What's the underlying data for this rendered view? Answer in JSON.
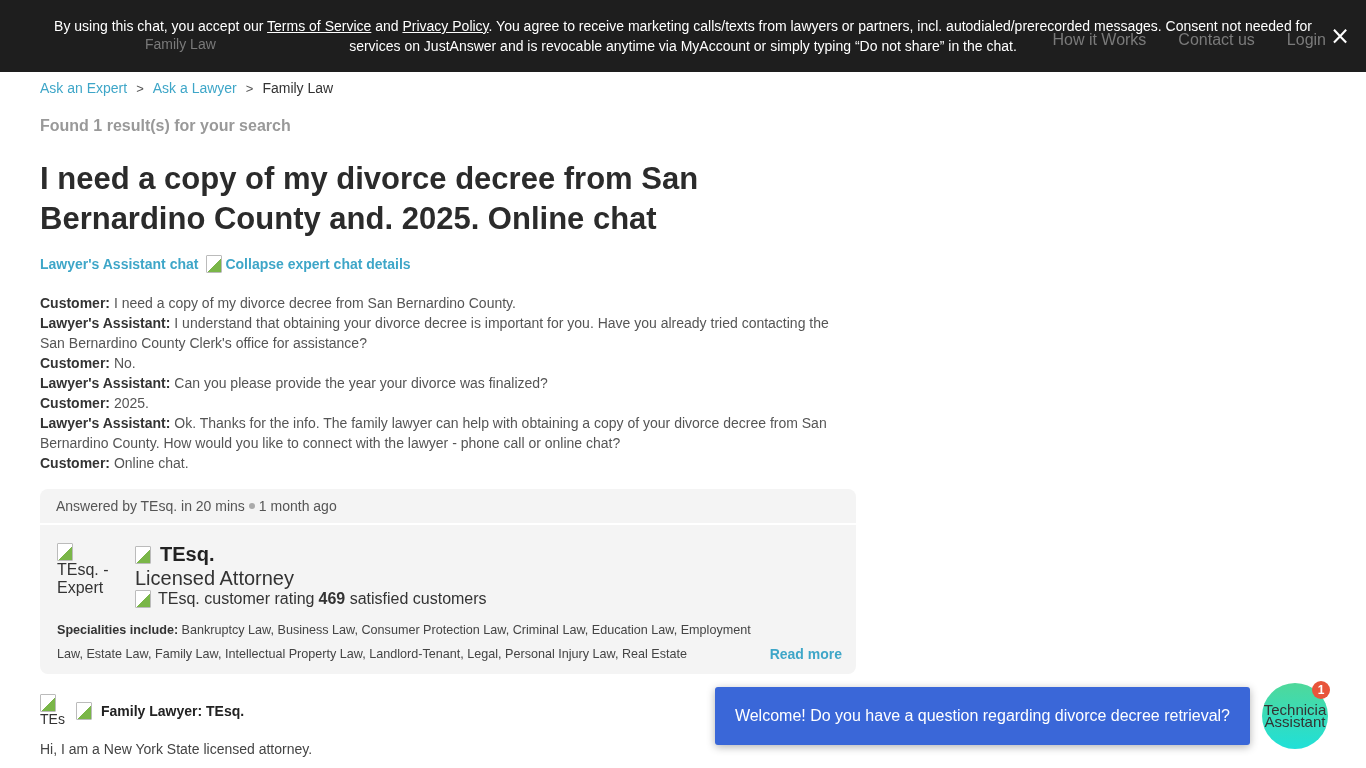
{
  "consent_banner": {
    "lines": [
      [
        {
          "kind": "text",
          "text": "By using this chat, you accept our "
        },
        {
          "kind": "link",
          "text": "Terms of Service"
        },
        {
          "kind": "text",
          "text": " and "
        },
        {
          "kind": "link",
          "text": "Privacy Policy"
        },
        {
          "kind": "text",
          "text": ". You agree to receive marketing calls/texts from lawyers or partners, incl. autodialed/prerecorded messages. Consent not needed for"
        }
      ],
      [
        {
          "kind": "text",
          "text": "services on JustAnswer and is revocable anytime via MyAccount or simply typing “Do not share” in the chat."
        }
      ]
    ],
    "close": "×"
  },
  "header": {
    "category": "Family Law",
    "links": [
      "How it Works",
      "Contact us",
      "Login"
    ]
  },
  "breadcrumbs": [
    {
      "label": "Ask an Expert",
      "link": true
    },
    {
      "label": "Ask a Lawyer",
      "link": true
    },
    {
      "label": "Family Law",
      "link": false
    }
  ],
  "breadcrumb_separator": ">",
  "results_note": "Found 1 result(s) for your search",
  "title": "I need a copy of my divorce decree from San Bernardino County and. 2025. Online chat",
  "chat_header": {
    "label": "Lawyer's Assistant chat",
    "toggle": "Collapse expert chat details"
  },
  "transcript": [
    {
      "speaker": "Customer:",
      "text": "I need a copy of my divorce decree from San Bernardino County."
    },
    {
      "speaker": "Lawyer's Assistant:",
      "text": "I understand that obtaining your divorce decree is important for you. Have you already tried contacting the San Bernardino County Clerk's office for assistance?"
    },
    {
      "speaker": "Customer:",
      "text": "No."
    },
    {
      "speaker": "Lawyer's Assistant:",
      "text": "Can you please provide the year your divorce was finalized?"
    },
    {
      "speaker": "Customer:",
      "text": "2025."
    },
    {
      "speaker": "Lawyer's Assistant:",
      "text": "Ok. Thanks for the info. The family lawyer can help with obtaining a copy of your divorce decree from San Bernardino County. How would you like to connect with the lawyer - phone call or online chat?"
    },
    {
      "speaker": "Customer:",
      "text": "Online chat."
    }
  ],
  "answer_card": {
    "answered_by": "Answered by TEsq. in 20 mins",
    "time": "1 month ago",
    "avatar_alt": "TEsq. - Expert",
    "name": "TEsq.",
    "title": "Licensed Attorney",
    "rating_alt": "TEsq. customer rating",
    "satisfied": "**469** satisfied customers",
    "specialities_label": "Specialities include:",
    "specialities": "Bankruptcy Law, Business Law, Consumer Protection Law, Criminal Law, Education Law, Employment Law, Estate Law, Family Law, Intellectual Property Law, Landlord-Tenant, Legal, Personal Injury Law, Real Estate",
    "read_more": "Read more"
  },
  "reply": {
    "avatar_alt": "TEs",
    "author": "Family Lawyer: TEsq.",
    "text": "Hi, I am a New York State licensed attorney."
  },
  "chat_widget": {
    "message": "Welcome! Do you have a question regarding divorce decree retrieval?",
    "avatar_lines": [
      "Technicia",
      "Assistant"
    ],
    "badge": "1"
  }
}
